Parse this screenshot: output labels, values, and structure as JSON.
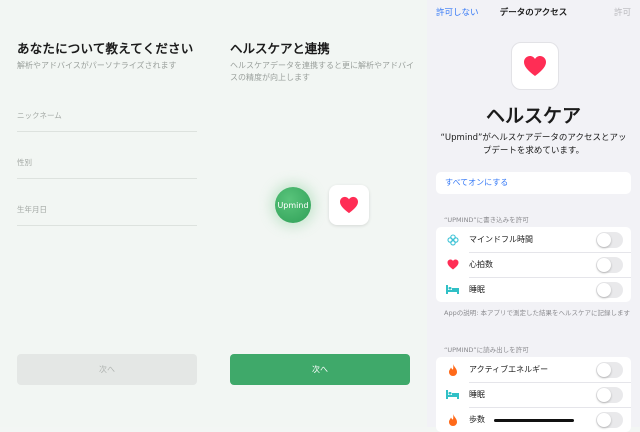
{
  "profile": {
    "title": "あなたについて教えてください",
    "subtitle": "解析やアドバイスがパーソナライズされます",
    "fields": [
      {
        "label": "ニックネーム"
      },
      {
        "label": "性別"
      },
      {
        "label": "生年月日"
      }
    ],
    "next_label": "次へ"
  },
  "healthcare": {
    "title": "ヘルスケアと連携",
    "subtitle": "ヘルスケアデータを連携すると更に解析やアドバイスの精度が向上します",
    "upmind_logo_text": "Upmind",
    "next_label": "次へ"
  },
  "access_sheet": {
    "nav_left": "許可しない",
    "nav_title": "データのアクセス",
    "nav_right": "許可",
    "app_name": "ヘルスケア",
    "description": "“Upmind”がヘルスケアデータのアクセスとアップデートを求めています。",
    "turn_all_on": "すべてオンにする",
    "write_section": "“UPMIND”に書き込みを許可",
    "write_items": [
      {
        "label": "マインドフル時間",
        "icon": "mindfulness-icon",
        "enabled": false
      },
      {
        "label": "心拍数",
        "icon": "heart-icon",
        "enabled": false
      },
      {
        "label": "睡眠",
        "icon": "bed-icon",
        "enabled": false
      }
    ],
    "app_note": "Appの説明: 本アプリで測定した結果をヘルスケアに記録します",
    "read_section": "“UPMIND”に読み出しを許可",
    "read_items": [
      {
        "label": "アクティブエネルギー",
        "icon": "flame-icon",
        "enabled": false
      },
      {
        "label": "睡眠",
        "icon": "bed-icon",
        "enabled": false
      },
      {
        "label": "歩数",
        "icon": "flame-icon",
        "enabled": false
      }
    ]
  },
  "colors": {
    "accent_green": "#3fa96a",
    "ios_blue": "#3478f6",
    "heart_red": "#ff2d55",
    "bed_teal": "#30c0c6",
    "flame_orange": "#ff6a1a"
  }
}
